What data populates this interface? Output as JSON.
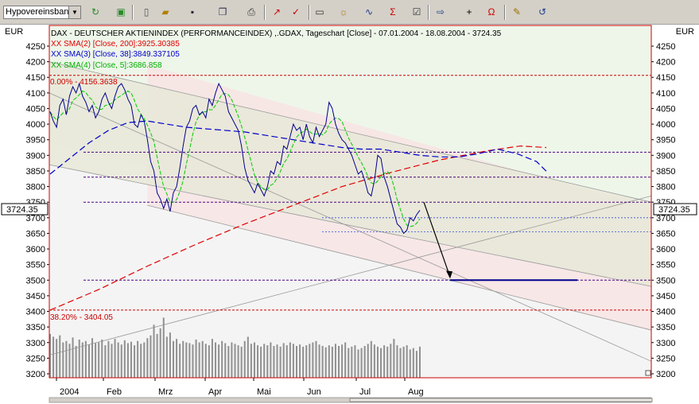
{
  "toolbar": {
    "broker_select_value": "Hypovereinsban",
    "buttons": [
      "refresh-icon",
      "calculator-icon",
      "new-icon",
      "open-icon",
      "save-icon",
      "copy-icon",
      "print-icon",
      "chart-line-icon",
      "chart-check-icon",
      "chart-type-icon",
      "indicator-icon",
      "analysis-icon",
      "sigma-icon",
      "properties-icon",
      "arrow-icon",
      "crosshair-icon",
      "magnet-icon",
      "info-icon",
      "undo-icon"
    ]
  },
  "axes": {
    "unit_left": "EUR",
    "unit_right": "EUR",
    "current_value_label": "3724.35"
  },
  "legend": {
    "title": "DAX  - DEUTSCHER AKTIENINDEX (PERFORMANCEINDEX) ,.GDAX, Tageschart [Close] - 07.01.2004 - 18.08.2004 - 3724.35",
    "sma2": "XX SMA(2) [Close, 200]:3925.30385",
    "sma3": "XX SMA(3) [Close, 38]:3849.337105",
    "sma4": "XX SMA(4) [Close, 5]:3686.858",
    "fib_top": "0.00% - 4156.3638",
    "fib_bottom": "38.20% - 3404.05"
  },
  "colors": {
    "price": "#00008b",
    "sma200": "#e00000",
    "sma38": "#0000cc",
    "sma5": "#00cc00",
    "fib": "#cc0000",
    "hline": "#4b0082",
    "border": "#cc0000"
  },
  "chart_data": {
    "type": "line",
    "title": "DAX  - DEUTSCHER AKTIENINDEX (PERFORMANCEINDEX) ,.GDAX, Tageschart [Close] - 07.01.2004 - 18.08.2004 - 3724.35",
    "ylim": [
      3200,
      4270
    ],
    "y_ticks": [
      3200,
      3250,
      3300,
      3350,
      3400,
      3450,
      3500,
      3550,
      3600,
      3650,
      3700,
      3750,
      3800,
      3850,
      3900,
      3950,
      4000,
      4050,
      4100,
      4150,
      4200,
      4250
    ],
    "x_tick_labels": [
      "2004",
      "Feb",
      "Mrz",
      "Apr",
      "Mai",
      "Jun",
      "Jul",
      "Aug"
    ],
    "price": [
      4040,
      4010,
      3990,
      4060,
      4080,
      4030,
      4090,
      4120,
      4100,
      4130,
      4090,
      4070,
      4040,
      4060,
      4020,
      4040,
      4080,
      4100,
      4070,
      4050,
      4090,
      4120,
      4130,
      4110,
      4080,
      4060,
      4000,
      3990,
      4030,
      4010,
      3950,
      3880,
      3850,
      3780,
      3760,
      3730,
      3760,
      3720,
      3780,
      3800,
      3860,
      3930,
      3990,
      4010,
      4050,
      4060,
      4030,
      4040,
      4020,
      4080,
      4060,
      4100,
      4130,
      4110,
      4090,
      4040,
      4020,
      4000,
      3980,
      3930,
      3860,
      3820,
      3800,
      3780,
      3810,
      3790,
      3770,
      3800,
      3850,
      3840,
      3880,
      3870,
      3930,
      3920,
      3960,
      4000,
      3980,
      3990,
      3950,
      4000,
      3960,
      3940,
      3990,
      3960,
      3980,
      4000,
      4070,
      4050,
      4000,
      3970,
      3950,
      3940,
      3920,
      3900,
      3870,
      3840,
      3850,
      3820,
      3780,
      3770,
      3820,
      3900,
      3890,
      3830,
      3800,
      3760,
      3720,
      3680,
      3670,
      3650,
      3660,
      3700,
      3690,
      3710,
      3724
    ],
    "sma200": [
      [
        0,
        3404
      ],
      [
        15,
        3470
      ],
      [
        30,
        3545
      ],
      [
        45,
        3615
      ],
      [
        60,
        3680
      ],
      [
        75,
        3740
      ],
      [
        90,
        3800
      ],
      [
        105,
        3845
      ],
      [
        120,
        3885
      ],
      [
        135,
        3915
      ],
      [
        145,
        3930
      ],
      [
        153,
        3925
      ]
    ],
    "sma38": [
      [
        0,
        3840
      ],
      [
        6,
        3890
      ],
      [
        12,
        3940
      ],
      [
        18,
        3980
      ],
      [
        24,
        4005
      ],
      [
        30,
        4010
      ],
      [
        36,
        4000
      ],
      [
        42,
        3990
      ],
      [
        48,
        3985
      ],
      [
        54,
        3980
      ],
      [
        60,
        3975
      ],
      [
        66,
        3965
      ],
      [
        72,
        3955
      ],
      [
        78,
        3945
      ],
      [
        84,
        3935
      ],
      [
        90,
        3925
      ],
      [
        96,
        3920
      ],
      [
        102,
        3920
      ],
      [
        108,
        3910
      ],
      [
        114,
        3900
      ],
      [
        120,
        3895
      ],
      [
        126,
        3895
      ],
      [
        132,
        3905
      ],
      [
        138,
        3920
      ],
      [
        144,
        3905
      ],
      [
        150,
        3880
      ],
      [
        153,
        3849
      ]
    ],
    "fibonacci": [
      {
        "level": "0.00%",
        "value": 4156.3638
      },
      {
        "level": "38.20%",
        "value": 3404.05
      }
    ],
    "support_levels": [
      3910,
      3830,
      3750,
      3500
    ],
    "target_level": 3500,
    "volume": [
      62,
      58,
      55,
      60,
      50,
      52,
      48,
      57,
      45,
      54,
      50,
      52,
      47,
      56,
      49,
      50,
      54,
      46,
      52,
      48,
      55,
      50,
      47,
      53,
      49,
      51,
      46,
      52,
      48,
      50,
      56,
      60,
      75,
      62,
      70,
      85,
      58,
      64,
      52,
      55,
      48,
      52,
      50,
      49,
      47,
      54,
      50,
      52,
      48,
      46,
      55,
      50,
      47,
      52,
      49,
      45,
      50,
      48,
      46,
      44,
      52,
      58,
      48,
      50,
      46,
      44,
      48,
      46,
      50,
      45,
      47,
      44,
      49,
      46,
      50,
      48,
      45,
      47,
      44,
      46,
      48,
      50,
      52,
      47,
      45,
      43,
      46,
      44,
      48,
      45,
      47,
      50,
      42,
      44,
      46,
      40,
      42,
      45,
      48,
      52,
      47,
      44,
      42,
      46,
      44,
      48,
      55,
      46,
      42,
      44,
      46,
      40,
      42,
      38,
      44
    ]
  }
}
